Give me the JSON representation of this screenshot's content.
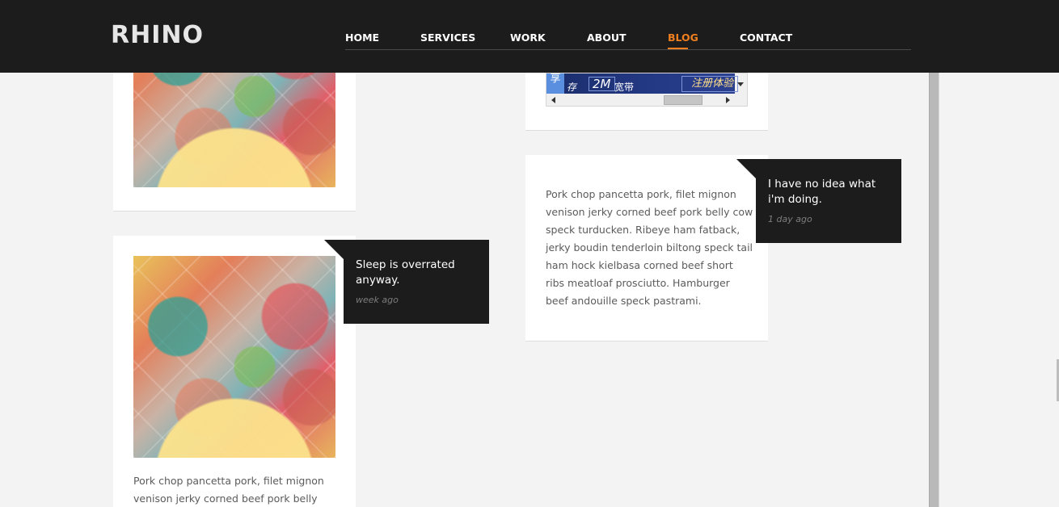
{
  "header": {
    "logo": "RHINO",
    "nav": [
      {
        "label": "HOME",
        "active": false
      },
      {
        "label": "SERVICES",
        "active": false
      },
      {
        "label": "WORK",
        "active": false
      },
      {
        "label": "ABOUT",
        "active": false
      },
      {
        "label": "BLOG",
        "active": true
      },
      {
        "label": "CONTACT",
        "active": false
      }
    ],
    "accent_color": "#f07f1f"
  },
  "ad": {
    "badge": "享",
    "text1": "存",
    "text2": "2M",
    "text3": "宽带",
    "text4": "注册体验"
  },
  "posts": [
    {
      "title": "Sleep is overrated anyway.",
      "time": "week ago",
      "excerpt": "Pork chop pancetta pork, filet mignon venison jerky corned beef pork belly cow"
    },
    {
      "title": "I have no idea what i'm doing.",
      "time": "1 day ago",
      "excerpt": "Pork chop pancetta pork, filet mignon venison jerky corned beef pork belly cow speck turducken. Ribeye ham fatback, jerky boudin tenderloin biltong speck tail ham hock kielbasa corned beef short ribs meatloaf prosciutto. Hamburger beef andouille speck pastrami."
    }
  ]
}
